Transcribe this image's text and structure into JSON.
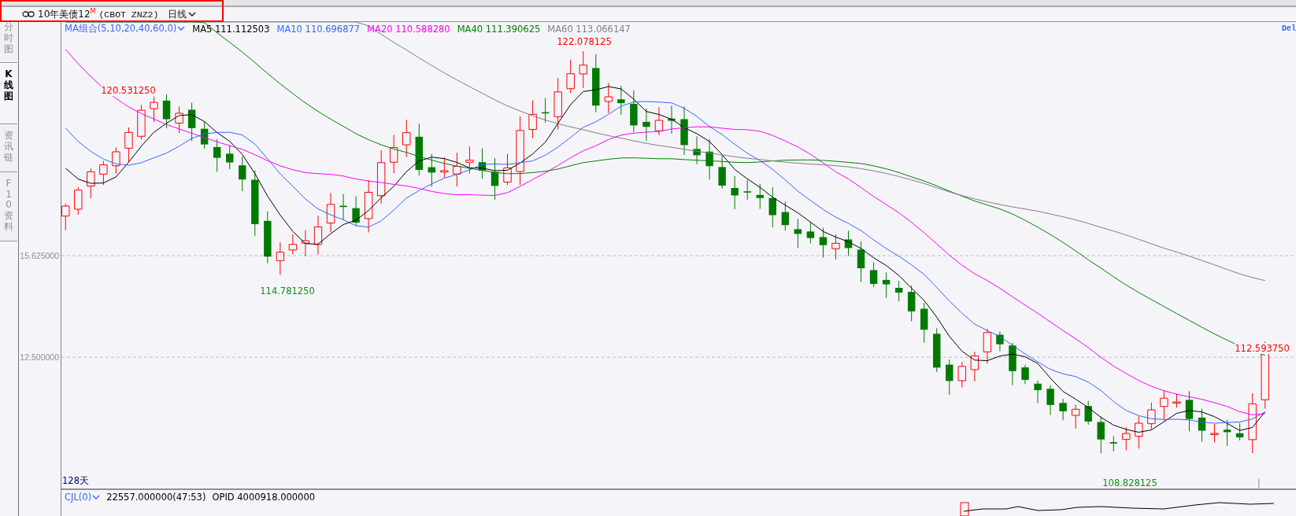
{
  "header": {
    "instrument": "10年美债12",
    "contract_mark": "M",
    "exchange_code": "(CBOT ZNZ2)",
    "period": "日线"
  },
  "sidebar": {
    "tabs": [
      {
        "label": "分时图",
        "selected": false
      },
      {
        "label": "K线图",
        "selected": true
      },
      {
        "label": "资讯链",
        "selected": false
      },
      {
        "label": "F10资料",
        "selected": false
      }
    ]
  },
  "chart": {
    "indicator_menu": "MA组合(5,10,20,40,60,0)",
    "ma_legend": [
      {
        "label": "MA5 111.112503",
        "color": "#000000"
      },
      {
        "label": "MA10 110.696877",
        "color": "#3366ff"
      },
      {
        "label": "MA20 110.588280",
        "color": "#ff00ff"
      },
      {
        "label": "MA40 111.390625",
        "color": "#008000"
      },
      {
        "label": "MA60 113.066147",
        "color": "#808080"
      }
    ],
    "corner_label": "Del",
    "y_axis_labels": [
      "15.625000",
      "12.500000"
    ],
    "price_marks": [
      {
        "text": "120.531250",
        "kind": "high"
      },
      {
        "text": "122.078125",
        "kind": "high"
      },
      {
        "text": "114.781250",
        "kind": "low"
      },
      {
        "text": "108.828125",
        "kind": "low"
      },
      {
        "text": "112.593750",
        "kind": "high"
      }
    ],
    "range_label": "128天"
  },
  "volume_panel": {
    "indicator_menu": "CJL(0)",
    "readings": [
      "22557.000000(47:53)",
      "OPID 4000918.000000"
    ]
  }
}
